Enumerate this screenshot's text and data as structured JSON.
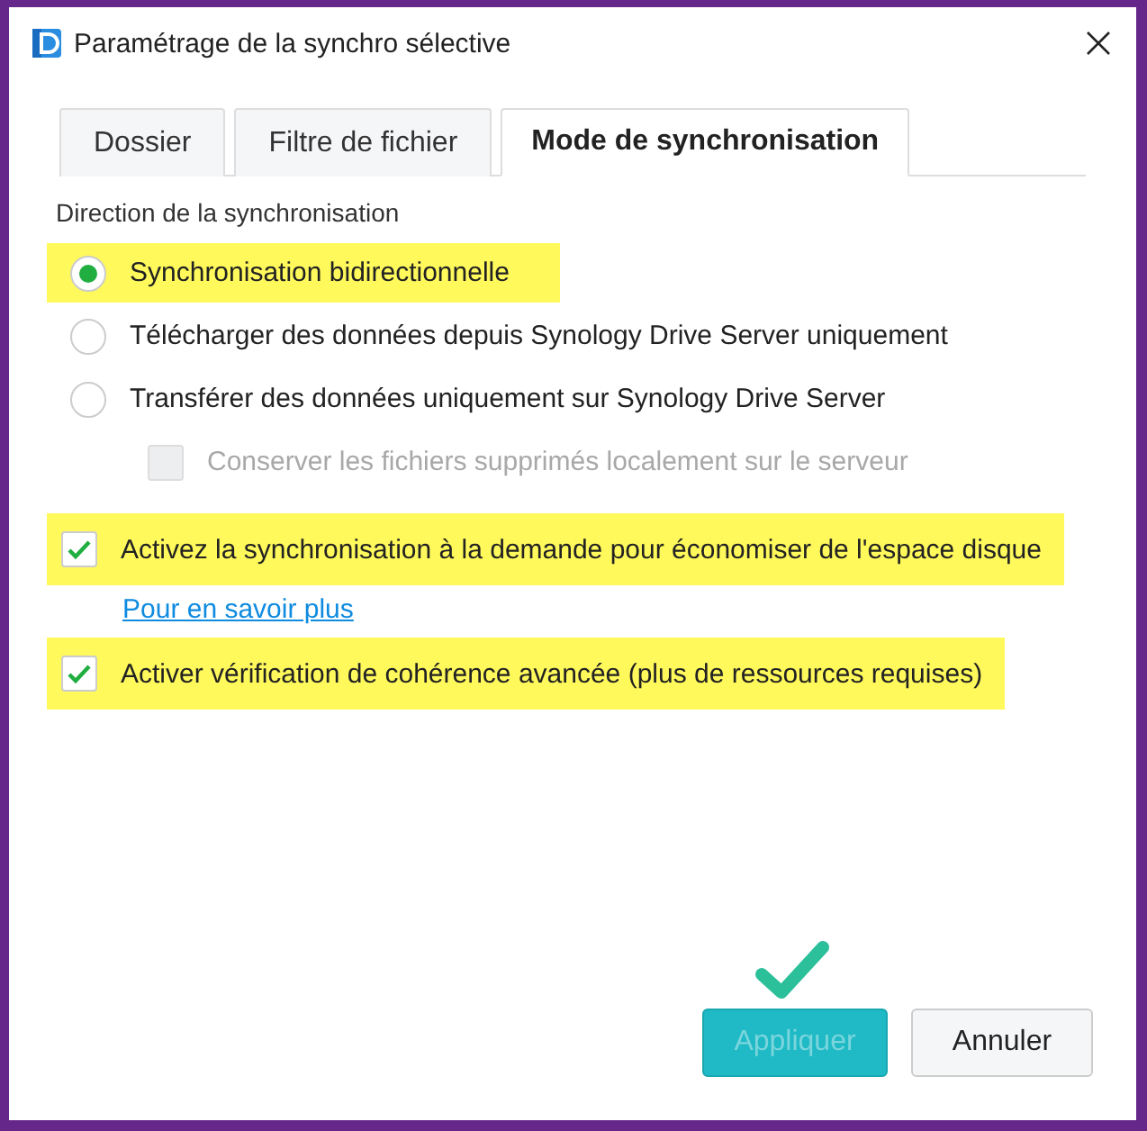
{
  "window": {
    "title": "Paramétrage de la synchro sélective"
  },
  "tabs": [
    {
      "label": "Dossier",
      "selected": false
    },
    {
      "label": "Filtre de fichier",
      "selected": false
    },
    {
      "label": "Mode de synchronisation",
      "selected": true
    }
  ],
  "section_label": "Direction de la synchronisation",
  "options": [
    {
      "kind": "radio",
      "label": "Synchronisation bidirectionnelle",
      "selected": true,
      "highlighted": true
    },
    {
      "kind": "radio",
      "label": "Télécharger des données depuis Synology Drive Server uniquement",
      "selected": false,
      "highlighted": false
    },
    {
      "kind": "radio",
      "label": "Transférer des données uniquement sur Synology Drive Server",
      "selected": false,
      "highlighted": false
    },
    {
      "kind": "subcheckbox",
      "label": "Conserver les fichiers supprimés localement sur le serveur",
      "checked": false,
      "highlighted": false,
      "disabled": true
    },
    {
      "kind": "checkbox",
      "label": "Activez la synchronisation à la demande pour économiser de l'espace disque",
      "checked": true,
      "highlighted": true,
      "disabled": false
    },
    {
      "kind": "link",
      "label": "Pour en savoir plus"
    },
    {
      "kind": "checkbox",
      "label": "Activer vérification de cohérence avancée (plus de ressources requises)",
      "checked": true,
      "highlighted": true,
      "disabled": false
    }
  ],
  "buttons": [
    {
      "label": "Appliquer",
      "kind": "primary",
      "disabled": true
    },
    {
      "label": "Annuler",
      "kind": "secondary",
      "disabled": false
    }
  ]
}
